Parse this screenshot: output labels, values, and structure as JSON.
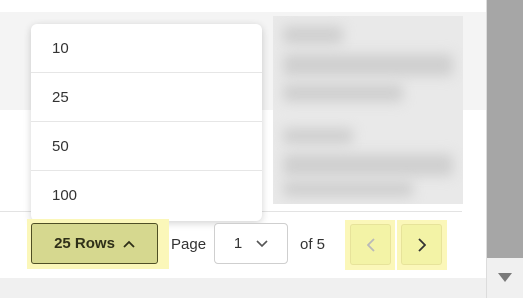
{
  "menu": {
    "options": [
      "10",
      "25",
      "50",
      "100"
    ]
  },
  "pagination": {
    "rows_label": "25 Rows",
    "page_label": "Page",
    "current_page": "1",
    "of_label": "of 5"
  },
  "colors": {
    "highlight": "#fbf7b9",
    "rows_button_bg": "#d6d88f",
    "nav_button_bg": "#f3f3a6"
  },
  "icons": {
    "rows_button": "chevron-up-icon",
    "page_select": "chevron-down-icon",
    "prev": "chevron-left-icon",
    "next": "chevron-right-icon",
    "scroll_down": "triangle-down-icon"
  }
}
